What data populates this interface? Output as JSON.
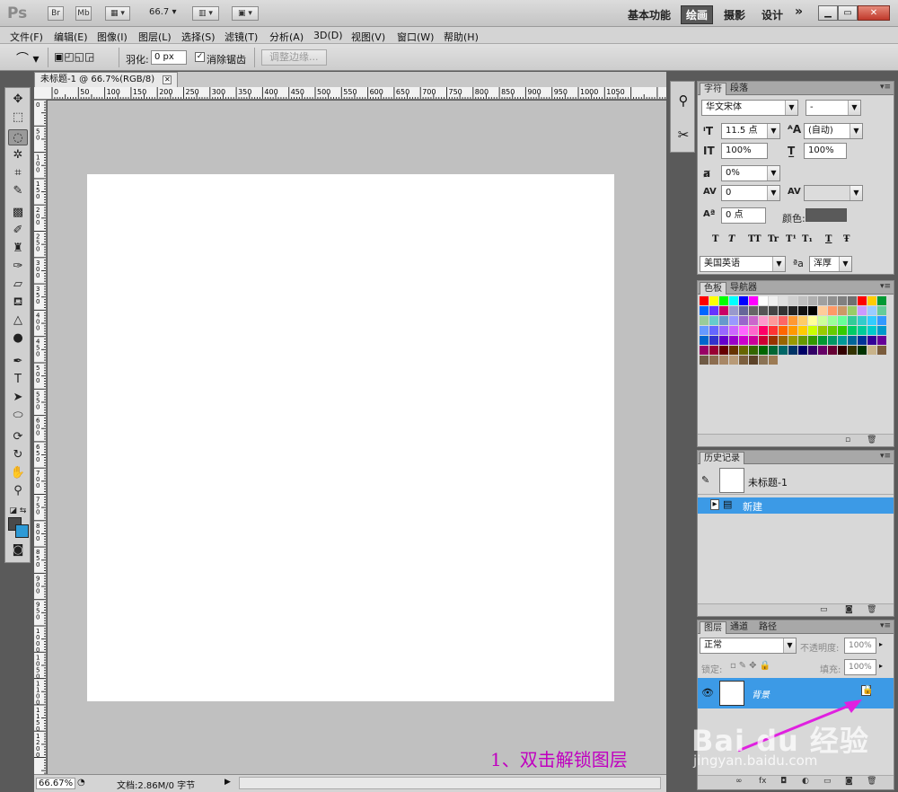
{
  "app": {
    "logo": "Ps",
    "bridge": "Br",
    "minibridge": "Mb",
    "zoom_value": "66.7",
    "workspaces": [
      "基本功能",
      "绘画",
      "摄影",
      "设计"
    ],
    "active_workspace": "绘画",
    "more": "»"
  },
  "menu": [
    "文件(F)",
    "编辑(E)",
    "图像(I)",
    "图层(L)",
    "选择(S)",
    "滤镜(T)",
    "分析(A)",
    "3D(D)",
    "视图(V)",
    "窗口(W)",
    "帮助(H)"
  ],
  "options": {
    "feather_label": "羽化:",
    "feather_value": "0 px",
    "antialias_label": "消除锯齿",
    "antialias_checked": "✓",
    "refine_edge": "调整边缘..."
  },
  "document": {
    "tab_title": "未标题-1 @ 66.7%(RGB/8)",
    "ruler_top": [
      "0",
      "50",
      "100",
      "150",
      "200",
      "250",
      "300",
      "350",
      "400",
      "450",
      "500",
      "550",
      "600",
      "650",
      "700",
      "750",
      "800",
      "850",
      "900",
      "950",
      "1000",
      "1050"
    ],
    "ruler_left": [
      "0",
      "50",
      "100",
      "150",
      "200",
      "250",
      "300",
      "350",
      "400",
      "450",
      "500",
      "550",
      "600",
      "650",
      "700",
      "750",
      "800",
      "850",
      "900",
      "950",
      "1000",
      "1050",
      "1100",
      "1150",
      "1200"
    ],
    "zoom": "66.67%",
    "doc_info": "文档:2.86M/0 字节"
  },
  "character_panel": {
    "tabs": [
      "字符",
      "段落"
    ],
    "font_family": "华文宋体",
    "font_style": "-",
    "font_size": "11.5 点",
    "leading": "(自动)",
    "vertical_scale": "100%",
    "horizontal_scale": "100%",
    "tracking_pct": "0%",
    "kerning": "0",
    "baseline": "0 点",
    "color_label": "颜色:",
    "text_color": "#5a5a5a",
    "style_buttons": [
      "T",
      "T",
      "TT",
      "Tr",
      "T¹",
      "T₁",
      "T",
      "Ŧ"
    ],
    "language": "美国英语",
    "aa_label": "ªa",
    "aa_mode": "浑厚"
  },
  "swatches_panel": {
    "tabs": [
      "色板",
      "导航器"
    ],
    "rows": [
      [
        "#ff0000",
        "#ffff00",
        "#00ff00",
        "#00ffff",
        "#0000ff",
        "#ff00ff",
        "#ffffff",
        "#f0f0f0",
        "#e0e0e0",
        "#d0d0d0",
        "#c0c0c0",
        "#b0b0b0",
        "#a0a0a0",
        "#909090",
        "#808080",
        "#707070",
        "#ff0000",
        "#ffcc00",
        "#009933"
      ],
      [
        "#0066ff",
        "#6633ff",
        "#cc0066",
        "#9999cc",
        "#666699",
        "#666666",
        "#555555",
        "#444444",
        "#333333",
        "#222222",
        "#111111",
        "#000000",
        "#ffcc99",
        "#ff9966",
        "#cc9966",
        "#99cc66",
        "#cc99ff",
        "#99ccff",
        "#66cc99"
      ],
      [
        "#99cc99",
        "#66cccc",
        "#6699cc",
        "#9999ff",
        "#9966cc",
        "#cc66cc",
        "#ff99cc",
        "#ff9999",
        "#ff6666",
        "#ff9933",
        "#ffcc66",
        "#ffff99",
        "#ccff99",
        "#99ff99",
        "#66ff99",
        "#33cc99",
        "#33cccc",
        "#33ccff",
        "#3399ff"
      ],
      [
        "#6699ff",
        "#6666ff",
        "#9966ff",
        "#cc66ff",
        "#ff66ff",
        "#ff66cc",
        "#ff0066",
        "#ff3333",
        "#ff6600",
        "#ff9900",
        "#ffcc00",
        "#ccff00",
        "#99cc00",
        "#66cc00",
        "#33cc00",
        "#00cc66",
        "#00cc99",
        "#00cccc",
        "#0099cc"
      ],
      [
        "#0066cc",
        "#3333cc",
        "#6600cc",
        "#9900cc",
        "#cc00cc",
        "#cc0099",
        "#cc0033",
        "#993300",
        "#996600",
        "#999900",
        "#669900",
        "#339900",
        "#009933",
        "#009966",
        "#009999",
        "#006699",
        "#003399",
        "#330099",
        "#660099"
      ],
      [
        "#990066",
        "#990033",
        "#660000",
        "#663300",
        "#666600",
        "#336600",
        "#006600",
        "#006633",
        "#006666",
        "#003366",
        "#000066",
        "#330066",
        "#660066",
        "#660033",
        "#330000",
        "#333300",
        "#003300",
        "#c9b38a",
        "#7a5c3c"
      ],
      [
        "#6e5a45",
        "#8c6d4f",
        "#a88766",
        "#b89a77",
        "#7c5f3e",
        "#5c4228",
        "#8b7355",
        "#9c7b54"
      ]
    ]
  },
  "history_panel": {
    "tabs": [
      "历史记录"
    ],
    "snapshot": "未标题-1",
    "items": [
      "新建"
    ]
  },
  "layers_panel": {
    "tabs": [
      "图层",
      "通道",
      "路径"
    ],
    "blend_mode": "正常",
    "opacity_label": "不透明度:",
    "opacity": "100%",
    "lock_label": "锁定:",
    "fill_label": "填充:",
    "fill": "100%",
    "layers": [
      {
        "name": "背景",
        "locked": true
      }
    ]
  },
  "annotation": "1、双击解锁图层",
  "watermark": {
    "brand": "Bai du 经验",
    "url": "jingyan.baidu.com"
  }
}
